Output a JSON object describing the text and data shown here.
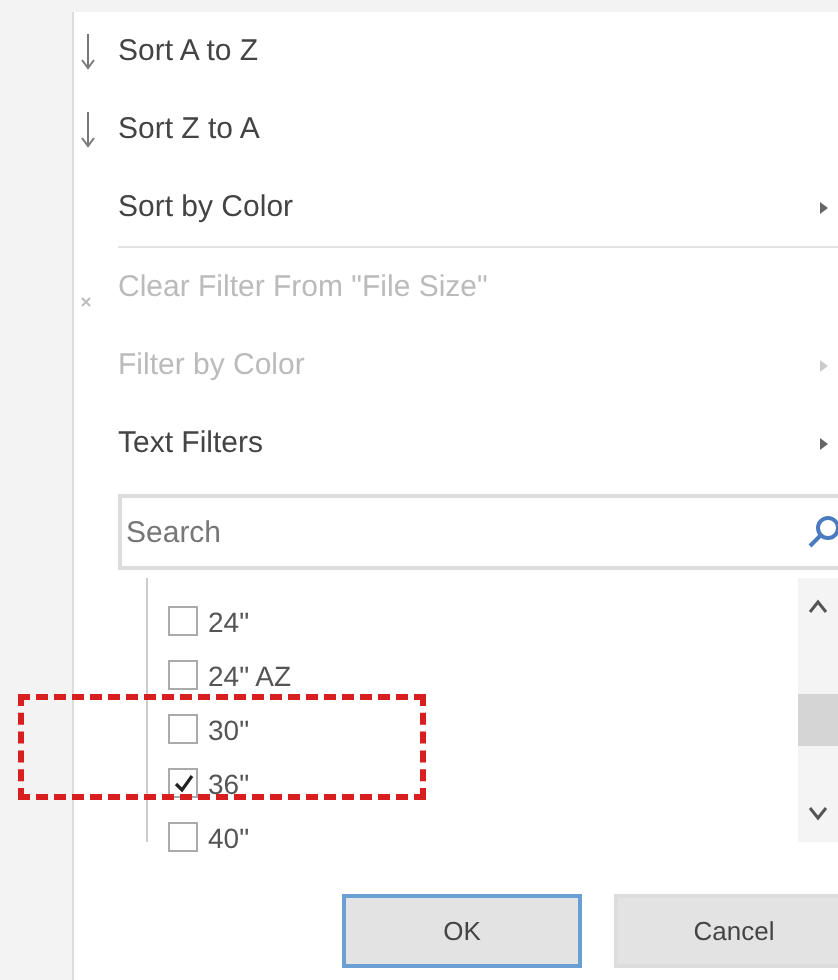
{
  "menu_items": [
    {
      "label": "Sort A to Z",
      "kind": "sort",
      "submenu": false,
      "disabled": false
    },
    {
      "label": "Sort Z to A",
      "kind": "sort",
      "submenu": false,
      "disabled": false
    },
    {
      "label": "Sort by Color",
      "kind": "plain",
      "submenu": true,
      "disabled": false,
      "divider_after": true
    },
    {
      "label": "Clear Filter From \"File Size\"",
      "kind": "clear",
      "submenu": false,
      "disabled": true
    },
    {
      "label": "Filter by Color",
      "kind": "plain",
      "submenu": true,
      "disabled": true
    },
    {
      "label": "Text Filters",
      "kind": "plain",
      "submenu": true,
      "disabled": false
    }
  ],
  "search": {
    "placeholder": "Search"
  },
  "values": [
    {
      "label": "24\"",
      "checked": false
    },
    {
      "label": "24\" AZ",
      "checked": false
    },
    {
      "label": "30\"",
      "checked": false
    },
    {
      "label": "36\"",
      "checked": true
    },
    {
      "label": "40\"",
      "checked": false
    }
  ],
  "buttons": [
    {
      "label": "OK",
      "default": true
    },
    {
      "label": "Cancel",
      "default": false
    }
  ],
  "annotation": {
    "kind": "dashed-box"
  }
}
